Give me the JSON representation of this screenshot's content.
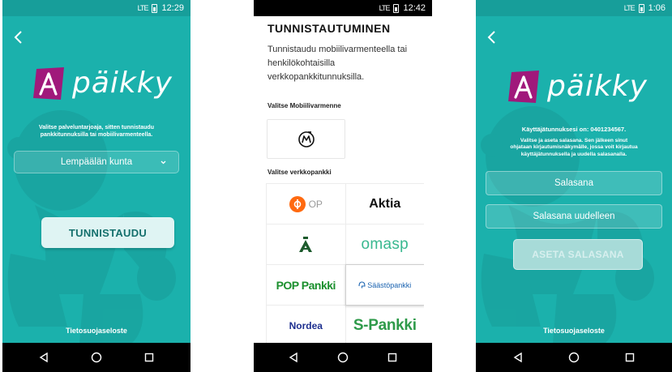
{
  "colors": {
    "teal": "#1bb1ac",
    "dark_teal": "#179e9a",
    "brand_pink": "#a0197b",
    "op_orange": "#ff6a10"
  },
  "status": {
    "time1": "12:29",
    "time2": "12:42",
    "time3": "1:06",
    "network": "LTE"
  },
  "icons": {
    "back": "back-chevron-icon",
    "dropdown": "chevron-down-icon",
    "nav": [
      "back-triangle-icon",
      "home-circle-icon",
      "recents-square-icon"
    ]
  },
  "logo": {
    "text": "päikky"
  },
  "screen1": {
    "instruction_line1": "Valitse palveluntarjoaja, sitten tunnistaudu",
    "instruction_line2": "pankkitunnuksilla tai mobiilivarmenteella.",
    "dropdown_value": "Lempäälän kunta",
    "button": "TUNNISTAUDU",
    "privacy": "Tietosuojaseloste"
  },
  "screen2": {
    "title": "TUNNISTAUTUMINEN",
    "intro": "Tunnistaudu mobiilivarmenteella tai henkilökohtaisilla verkkopankkitunnuksilla.",
    "mobiili_label": "Valitse Mobiilivarmenne",
    "bank_label": "Valitse verkkopankki",
    "banks": [
      "OP",
      "Aktia",
      "Ålandsbanken",
      "omasp",
      "POP Pankki",
      "Säästöpankki",
      "Nordea",
      "S-Pankki"
    ],
    "selected_bank": "Säästöpankki"
  },
  "screen3": {
    "username_info": "Käyttäjätunnuksesi on: 0401234567.",
    "instruction_line1": "Valitse ja aseta salasana. Sen jälkeen sinut",
    "instruction_line2": "ohjataan kirjautumisnäkymälle, jossa voit kirjautua",
    "instruction_line3": "käyttäjätunnuksella ja uudella salasanalla.",
    "password_placeholder": "Salasana",
    "password_repeat_placeholder": "Salasana uudelleen",
    "button": "ASETA SALASANA",
    "privacy": "Tietosuojaseloste"
  }
}
